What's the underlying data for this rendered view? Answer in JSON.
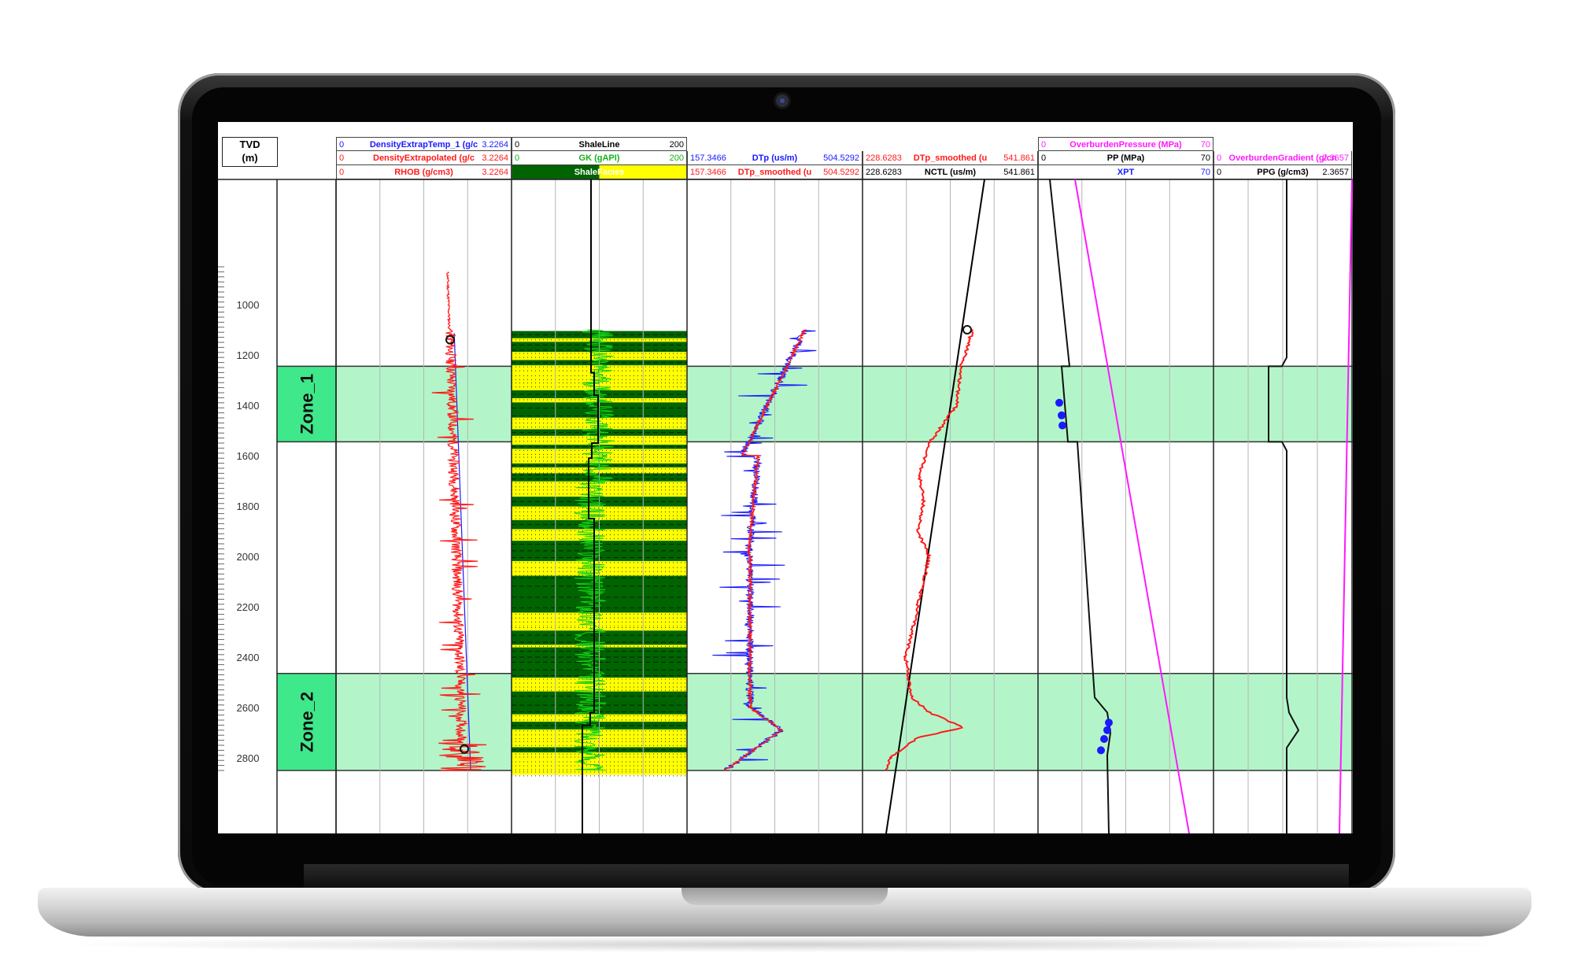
{
  "depth_header": {
    "line1": "TVD",
    "line2": "(m)"
  },
  "depth_ticks": [
    "1000",
    "1200",
    "1400",
    "1600",
    "1800",
    "2000",
    "2200",
    "2400",
    "2600",
    "2800"
  ],
  "zones": [
    {
      "name": "Zone_1"
    },
    {
      "name": "Zone_2"
    }
  ],
  "tracks": [
    {
      "headers": [
        {
          "min": "0",
          "name": "DensityExtrapTemp_1 (g/c",
          "max": "3.2264",
          "color": "#1a1aff"
        },
        {
          "min": "0",
          "name": "DensityExtrapolated (g/c",
          "max": "3.2264",
          "color": "#ff1a1a"
        },
        {
          "min": "0",
          "name": "RHOB (g/cm3)",
          "max": "3.2264",
          "color": "#ff1a1a"
        }
      ]
    },
    {
      "headers": [
        {
          "min": "0",
          "name": "ShaleLine",
          "max": "200",
          "color": "#000000"
        },
        {
          "min": "0",
          "name": "GK (gAPI)",
          "max": "200",
          "color": "#16b316"
        },
        {
          "min": "",
          "name": "ShaleFacies",
          "max": "",
          "color": "#ffffff",
          "fill_dark": "#006400",
          "fill_light": "#ffff00"
        }
      ]
    },
    {
      "headers": [
        {
          "min": "157.3466",
          "name": "DTp (us/m)",
          "max": "504.5292",
          "color": "#1a1aff"
        },
        {
          "min": "157.3466",
          "name": "DTp_smoothed (u",
          "max": "504.5292",
          "color": "#ff1a1a"
        }
      ]
    },
    {
      "headers": [
        {
          "min": "228.6283",
          "name": "DTp_smoothed (u",
          "max": "541.861",
          "color": "#ff1a1a"
        },
        {
          "min": "228.6283",
          "name": "NCTL (us/m)",
          "max": "541.861",
          "color": "#000000"
        }
      ]
    },
    {
      "headers": [
        {
          "min": "0",
          "name": "OverburdenPressure (MPa)",
          "max": "70",
          "color": "#ff19ff"
        },
        {
          "min": "0",
          "name": "PP (MPa)",
          "max": "70",
          "color": "#000000"
        },
        {
          "min": "",
          "name": "XPT",
          "max": "70",
          "color": "#1a1aff"
        }
      ]
    },
    {
      "headers": [
        {
          "min": "0",
          "name": "OverburdenGradient (g/cn",
          "max": "2.3657",
          "color": "#ff19ff"
        },
        {
          "min": "0",
          "name": "PPG (g/cm3)",
          "max": "2.3657",
          "color": "#000000"
        }
      ]
    }
  ],
  "colors": {
    "zone_fill": "#b3f5c9",
    "zone_label_fill": "#3fe88a",
    "grid": "#b5b5b5"
  }
}
